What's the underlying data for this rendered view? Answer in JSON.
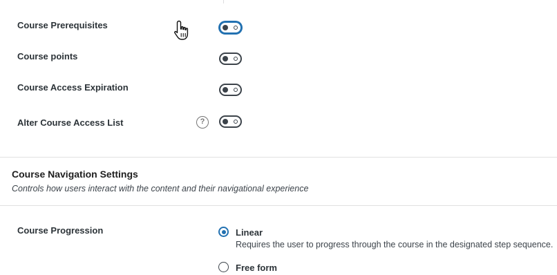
{
  "settings": {
    "prerequisites": {
      "label": "Course Prerequisites",
      "enabled": false
    },
    "points": {
      "label": "Course points",
      "enabled": false
    },
    "access_expiration": {
      "label": "Course Access Expiration",
      "enabled": false
    },
    "alter_access_list": {
      "label": "Alter Course Access List",
      "enabled": false,
      "help_glyph": "?"
    }
  },
  "navigation_section": {
    "title": "Course Navigation Settings",
    "description": "Controls how users interact with the content and their navigational experience"
  },
  "course_progression": {
    "label": "Course Progression",
    "selected": "linear",
    "options": [
      {
        "id": "linear",
        "label": "Linear",
        "description": "Requires the user to progress through the course in the designated step sequence."
      },
      {
        "id": "free_form",
        "label": "Free form"
      }
    ]
  },
  "colors": {
    "accent": "#2271b1",
    "toggle_off": "#3c434a"
  },
  "icons": {
    "cursor": "hand-pointer-icon",
    "help": "help-icon"
  }
}
